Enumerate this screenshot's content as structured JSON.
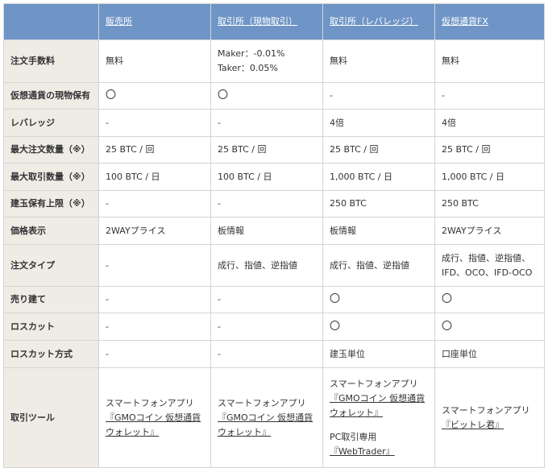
{
  "header": {
    "corner": "",
    "columns": [
      "販売所",
      "取引所（現物取引）",
      "取引所（レバレッジ）",
      "仮想通貨FX"
    ]
  },
  "rows": [
    {
      "label": "注文手数料",
      "cells": [
        {
          "lines": [
            "無料"
          ]
        },
        {
          "lines": [
            "Maker：-0.01%",
            "Taker：0.05%"
          ]
        },
        {
          "lines": [
            "無料"
          ]
        },
        {
          "lines": [
            "無料"
          ]
        }
      ]
    },
    {
      "label": "仮想通貨の現物保有",
      "cells": [
        {
          "lines": [
            "〇"
          ]
        },
        {
          "lines": [
            "〇"
          ]
        },
        {
          "lines": [
            "-"
          ]
        },
        {
          "lines": [
            "-"
          ]
        }
      ]
    },
    {
      "label": "レバレッジ",
      "cells": [
        {
          "lines": [
            "-"
          ]
        },
        {
          "lines": [
            "-"
          ]
        },
        {
          "lines": [
            "4倍"
          ]
        },
        {
          "lines": [
            "4倍"
          ]
        }
      ]
    },
    {
      "label": "最大注文数量（※）",
      "cells": [
        {
          "lines": [
            "25 BTC / 回"
          ]
        },
        {
          "lines": [
            "25 BTC / 回"
          ]
        },
        {
          "lines": [
            "25 BTC / 回"
          ]
        },
        {
          "lines": [
            "25 BTC / 回"
          ]
        }
      ]
    },
    {
      "label": "最大取引数量（※）",
      "cells": [
        {
          "lines": [
            "100 BTC / 日"
          ]
        },
        {
          "lines": [
            "100 BTC / 日"
          ]
        },
        {
          "lines": [
            "1,000 BTC / 日"
          ]
        },
        {
          "lines": [
            "1,000 BTC / 日"
          ]
        }
      ]
    },
    {
      "label": "建玉保有上限（※）",
      "cells": [
        {
          "lines": [
            "-"
          ]
        },
        {
          "lines": [
            "-"
          ]
        },
        {
          "lines": [
            "250 BTC"
          ]
        },
        {
          "lines": [
            "250 BTC"
          ]
        }
      ]
    },
    {
      "label": "価格表示",
      "cells": [
        {
          "lines": [
            "2WAYプライス"
          ]
        },
        {
          "lines": [
            "板情報"
          ]
        },
        {
          "lines": [
            "板情報"
          ]
        },
        {
          "lines": [
            "2WAYプライス"
          ]
        }
      ]
    },
    {
      "label": "注文タイプ",
      "cells": [
        {
          "lines": [
            "-"
          ]
        },
        {
          "lines": [
            "成行、指値、逆指値"
          ]
        },
        {
          "lines": [
            "成行、指値、逆指値"
          ]
        },
        {
          "lines": [
            "成行、指値、逆指値、",
            "IFD、OCO、IFD-OCO"
          ]
        }
      ]
    },
    {
      "label": "売り建て",
      "cells": [
        {
          "lines": [
            "-"
          ]
        },
        {
          "lines": [
            "-"
          ]
        },
        {
          "lines": [
            "〇"
          ]
        },
        {
          "lines": [
            "〇"
          ]
        }
      ]
    },
    {
      "label": "ロスカット",
      "cells": [
        {
          "lines": [
            "-"
          ]
        },
        {
          "lines": [
            "-"
          ]
        },
        {
          "lines": [
            "〇"
          ]
        },
        {
          "lines": [
            "〇"
          ]
        }
      ]
    },
    {
      "label": "ロスカット方式",
      "cells": [
        {
          "lines": [
            "-"
          ]
        },
        {
          "lines": [
            "-"
          ]
        },
        {
          "lines": [
            "建玉単位"
          ]
        },
        {
          "lines": [
            "口座単位"
          ]
        }
      ]
    }
  ],
  "tools_row": {
    "label": "取引ツール",
    "col1": {
      "text": "スマートフォンアプリ",
      "link_line1": "『GMOコイン 仮想通貨",
      "link_line2": "ウォレット』"
    },
    "col2": {
      "text": "スマートフォンアプリ",
      "link_line1": "『GMOコイン 仮想通貨",
      "link_line2": "ウォレット』"
    },
    "col3": {
      "text": "スマートフォンアプリ",
      "link_line1": "『GMOコイン 仮想通貨",
      "link_line2": "ウォレット』",
      "pc_text": "PC取引専用",
      "pc_link": "『WebTrader』"
    },
    "col4": {
      "text": "スマートフォンアプリ",
      "link_line1": "『ビットレ君』"
    }
  }
}
